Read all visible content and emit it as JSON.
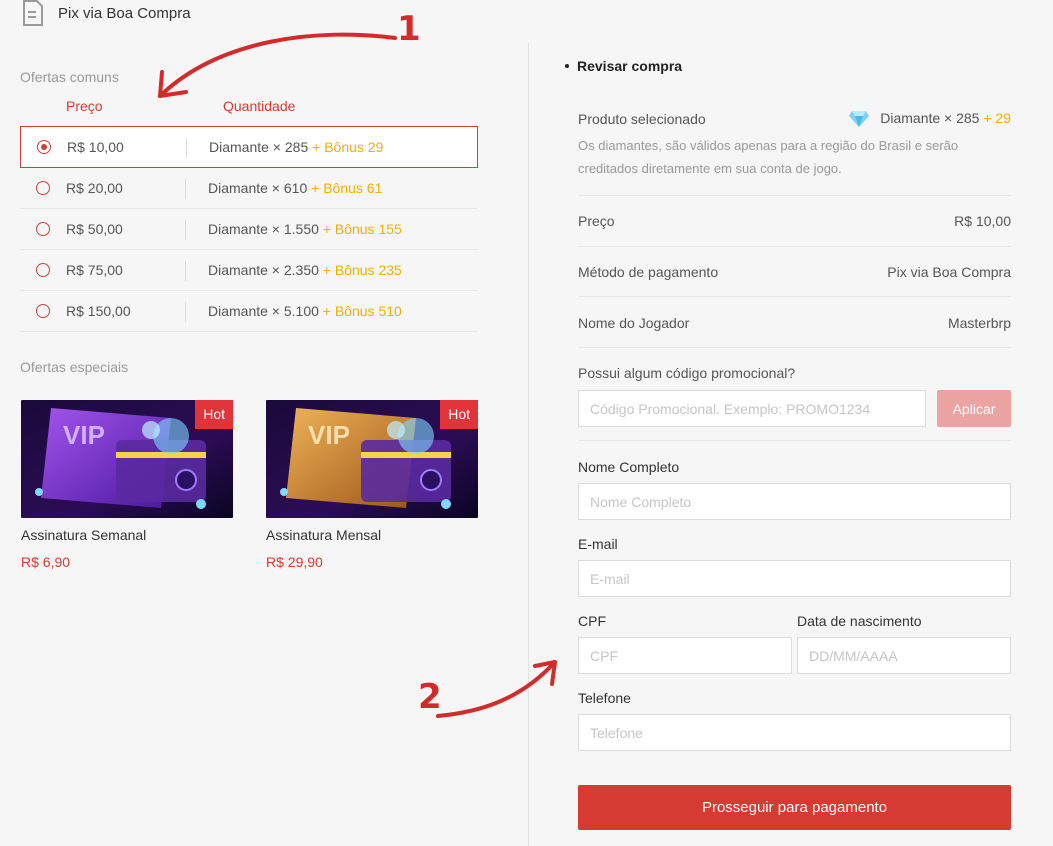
{
  "header": {
    "payment_method_label": "Pix via Boa Compra",
    "icon": "document-icon"
  },
  "offers": {
    "common_title": "Ofertas comuns",
    "col_price": "Preço",
    "col_quantity": "Quantidade",
    "items": [
      {
        "price": "R$ 10,00",
        "qty": "Diamante × 285",
        "bonus": "+ Bônus 29",
        "selected": true
      },
      {
        "price": "R$ 20,00",
        "qty": "Diamante × 610",
        "bonus": "+ Bônus 61",
        "selected": false
      },
      {
        "price": "R$ 50,00",
        "qty": "Diamante × 1.550",
        "bonus": "+ Bônus 155",
        "selected": false
      },
      {
        "price": "R$ 75,00",
        "qty": "Diamante × 2.350",
        "bonus": "+ Bônus 235",
        "selected": false
      },
      {
        "price": "R$ 150,00",
        "qty": "Diamante × 5.100",
        "bonus": "+ Bônus 510",
        "selected": false
      }
    ],
    "special_title": "Ofertas especiais",
    "special_items": [
      {
        "name": "Assinatura Semanal",
        "price": "R$ 6,90",
        "badge": "Hot",
        "card_text": "VIP"
      },
      {
        "name": "Assinatura Mensal",
        "price": "R$ 29,90",
        "badge": "Hot",
        "card_text": "VIP"
      }
    ]
  },
  "review": {
    "title": "Revisar compra",
    "product_label": "Produto selecionado",
    "product_value": "Diamante × 285",
    "product_bonus": "+ 29",
    "note": "Os diamantes, são válidos apenas para a região do Brasil e serão creditados diretamente em sua conta de jogo.",
    "price_label": "Preço",
    "price_value": "R$ 10,00",
    "method_label": "Método de pagamento",
    "method_value": "Pix via Boa Compra",
    "player_label": "Nome do Jogador",
    "player_value": "Masterbrp",
    "promo_question": "Possui algum código promocional?",
    "promo_placeholder": "Código Promocional. Exemplo: PROMO1234",
    "apply_label": "Aplicar"
  },
  "form": {
    "fullname_label": "Nome Completo",
    "fullname_placeholder": "Nome Completo",
    "email_label": "E-mail",
    "email_placeholder": "E-mail",
    "cpf_label": "CPF",
    "cpf_placeholder": "CPF",
    "birth_label": "Data de nascimento",
    "birth_placeholder": "DD/MM/AAAA",
    "phone_label": "Telefone",
    "phone_placeholder": "Telefone",
    "submit_label": "Prosseguir para pagamento"
  },
  "annotations": {
    "arrow1_number": "1",
    "arrow2_number": "2"
  },
  "colors": {
    "accent": "#d63a32",
    "bonus": "#f2b100",
    "hot": "#e0333a",
    "apply_disabled": "#eba4a1"
  }
}
